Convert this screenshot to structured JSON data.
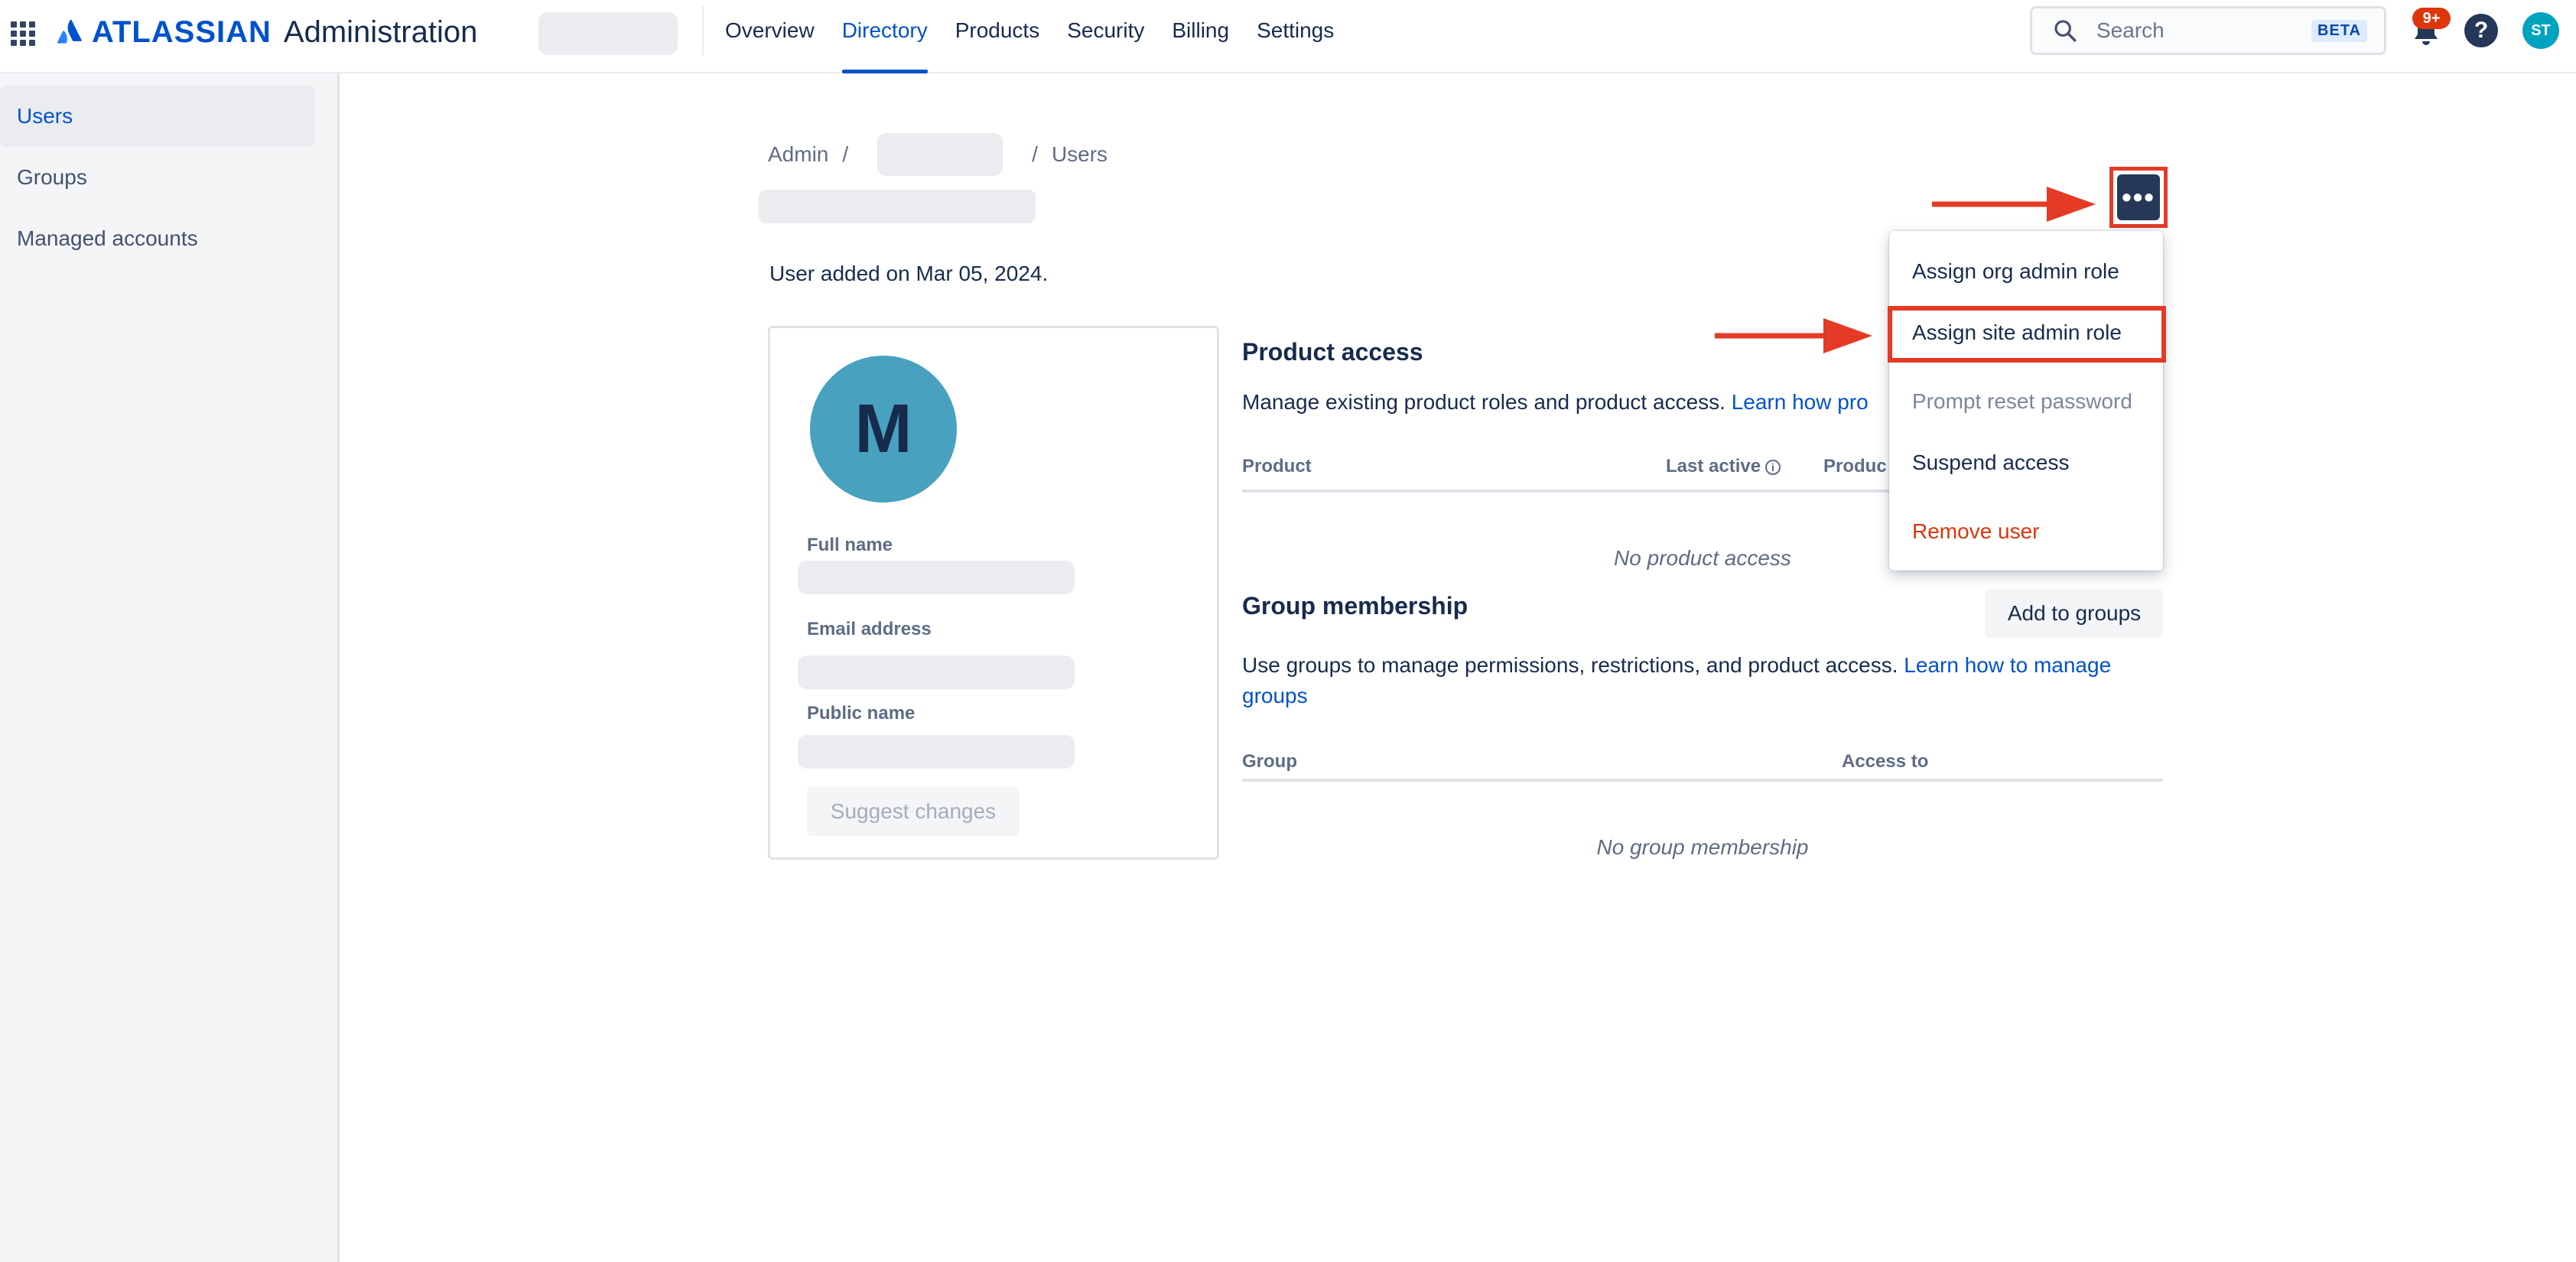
{
  "topnav": {
    "brand": "ATLASSIAN",
    "product": "Administration",
    "tabs": [
      {
        "label": "Overview",
        "active": false
      },
      {
        "label": "Directory",
        "active": true
      },
      {
        "label": "Products",
        "active": false
      },
      {
        "label": "Security",
        "active": false
      },
      {
        "label": "Billing",
        "active": false
      },
      {
        "label": "Settings",
        "active": false
      }
    ],
    "search": {
      "placeholder": "Search",
      "badge": "BETA"
    },
    "notifications_badge": "9+",
    "help_icon_text": "?",
    "user_initials": "ST"
  },
  "sidebar": {
    "items": [
      {
        "label": "Users",
        "active": true
      },
      {
        "label": "Groups",
        "active": false
      },
      {
        "label": "Managed accounts",
        "active": false
      }
    ]
  },
  "breadcrumb": {
    "root": "Admin",
    "separator": "/",
    "current": "Users"
  },
  "user": {
    "added_text": "User added on Mar 05, 2024.",
    "avatar_initial": "M",
    "fields": {
      "full_name_label": "Full name",
      "email_label": "Email address",
      "public_name_label": "Public name"
    },
    "suggest_changes_label": "Suggest changes"
  },
  "product_access": {
    "title": "Product access",
    "description": "Manage existing product roles and product access.",
    "link_text": "Learn how pro",
    "columns": {
      "product": "Product",
      "last_active": "Last active",
      "product_role": "Produc"
    },
    "info_icon": "i",
    "empty": "No product access"
  },
  "group_membership": {
    "title": "Group membership",
    "add_button": "Add to groups",
    "description": "Use groups to manage permissions, restrictions, and product access.",
    "link_text_line1": "Learn how to manage",
    "link_text_line2": "groups",
    "columns": {
      "group": "Group",
      "access_to": "Access to"
    },
    "empty": "No group membership"
  },
  "more_button": {
    "label": "•••"
  },
  "dropdown": {
    "items": [
      {
        "label": "Assign org admin role",
        "state": "normal"
      },
      {
        "label": "Assign site admin role",
        "state": "highlighted"
      },
      {
        "label": "Prompt reset password",
        "state": "disabled"
      },
      {
        "label": "Suspend access",
        "state": "normal"
      },
      {
        "label": "Remove user",
        "state": "danger"
      }
    ]
  },
  "colors": {
    "accent": "#0052cc",
    "annotation_red": "#e53a26",
    "danger": "#de350b",
    "avatar": "#47a1bf"
  }
}
